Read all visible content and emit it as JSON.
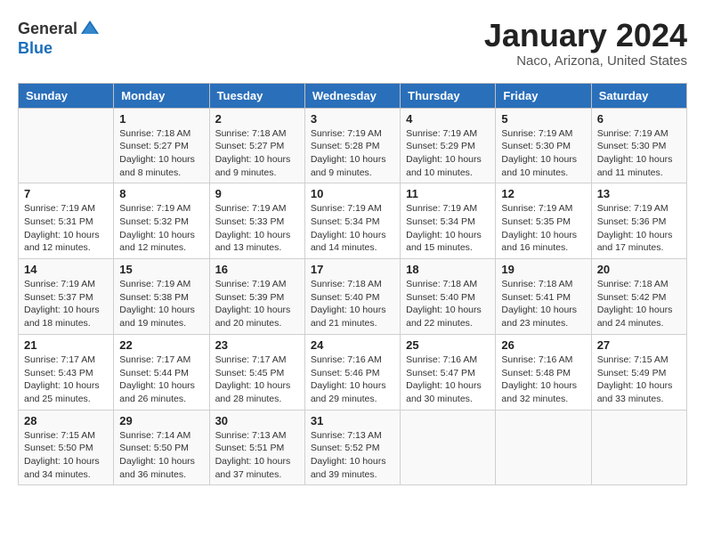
{
  "logo": {
    "general": "General",
    "blue": "Blue"
  },
  "title": "January 2024",
  "location": "Naco, Arizona, United States",
  "calendar": {
    "headers": [
      "Sunday",
      "Monday",
      "Tuesday",
      "Wednesday",
      "Thursday",
      "Friday",
      "Saturday"
    ],
    "weeks": [
      [
        {
          "day": "",
          "info": ""
        },
        {
          "day": "1",
          "info": "Sunrise: 7:18 AM\nSunset: 5:27 PM\nDaylight: 10 hours\nand 8 minutes."
        },
        {
          "day": "2",
          "info": "Sunrise: 7:18 AM\nSunset: 5:27 PM\nDaylight: 10 hours\nand 9 minutes."
        },
        {
          "day": "3",
          "info": "Sunrise: 7:19 AM\nSunset: 5:28 PM\nDaylight: 10 hours\nand 9 minutes."
        },
        {
          "day": "4",
          "info": "Sunrise: 7:19 AM\nSunset: 5:29 PM\nDaylight: 10 hours\nand 10 minutes."
        },
        {
          "day": "5",
          "info": "Sunrise: 7:19 AM\nSunset: 5:30 PM\nDaylight: 10 hours\nand 10 minutes."
        },
        {
          "day": "6",
          "info": "Sunrise: 7:19 AM\nSunset: 5:30 PM\nDaylight: 10 hours\nand 11 minutes."
        }
      ],
      [
        {
          "day": "7",
          "info": "Sunrise: 7:19 AM\nSunset: 5:31 PM\nDaylight: 10 hours\nand 12 minutes."
        },
        {
          "day": "8",
          "info": "Sunrise: 7:19 AM\nSunset: 5:32 PM\nDaylight: 10 hours\nand 12 minutes."
        },
        {
          "day": "9",
          "info": "Sunrise: 7:19 AM\nSunset: 5:33 PM\nDaylight: 10 hours\nand 13 minutes."
        },
        {
          "day": "10",
          "info": "Sunrise: 7:19 AM\nSunset: 5:34 PM\nDaylight: 10 hours\nand 14 minutes."
        },
        {
          "day": "11",
          "info": "Sunrise: 7:19 AM\nSunset: 5:34 PM\nDaylight: 10 hours\nand 15 minutes."
        },
        {
          "day": "12",
          "info": "Sunrise: 7:19 AM\nSunset: 5:35 PM\nDaylight: 10 hours\nand 16 minutes."
        },
        {
          "day": "13",
          "info": "Sunrise: 7:19 AM\nSunset: 5:36 PM\nDaylight: 10 hours\nand 17 minutes."
        }
      ],
      [
        {
          "day": "14",
          "info": "Sunrise: 7:19 AM\nSunset: 5:37 PM\nDaylight: 10 hours\nand 18 minutes."
        },
        {
          "day": "15",
          "info": "Sunrise: 7:19 AM\nSunset: 5:38 PM\nDaylight: 10 hours\nand 19 minutes."
        },
        {
          "day": "16",
          "info": "Sunrise: 7:19 AM\nSunset: 5:39 PM\nDaylight: 10 hours\nand 20 minutes."
        },
        {
          "day": "17",
          "info": "Sunrise: 7:18 AM\nSunset: 5:40 PM\nDaylight: 10 hours\nand 21 minutes."
        },
        {
          "day": "18",
          "info": "Sunrise: 7:18 AM\nSunset: 5:40 PM\nDaylight: 10 hours\nand 22 minutes."
        },
        {
          "day": "19",
          "info": "Sunrise: 7:18 AM\nSunset: 5:41 PM\nDaylight: 10 hours\nand 23 minutes."
        },
        {
          "day": "20",
          "info": "Sunrise: 7:18 AM\nSunset: 5:42 PM\nDaylight: 10 hours\nand 24 minutes."
        }
      ],
      [
        {
          "day": "21",
          "info": "Sunrise: 7:17 AM\nSunset: 5:43 PM\nDaylight: 10 hours\nand 25 minutes."
        },
        {
          "day": "22",
          "info": "Sunrise: 7:17 AM\nSunset: 5:44 PM\nDaylight: 10 hours\nand 26 minutes."
        },
        {
          "day": "23",
          "info": "Sunrise: 7:17 AM\nSunset: 5:45 PM\nDaylight: 10 hours\nand 28 minutes."
        },
        {
          "day": "24",
          "info": "Sunrise: 7:16 AM\nSunset: 5:46 PM\nDaylight: 10 hours\nand 29 minutes."
        },
        {
          "day": "25",
          "info": "Sunrise: 7:16 AM\nSunset: 5:47 PM\nDaylight: 10 hours\nand 30 minutes."
        },
        {
          "day": "26",
          "info": "Sunrise: 7:16 AM\nSunset: 5:48 PM\nDaylight: 10 hours\nand 32 minutes."
        },
        {
          "day": "27",
          "info": "Sunrise: 7:15 AM\nSunset: 5:49 PM\nDaylight: 10 hours\nand 33 minutes."
        }
      ],
      [
        {
          "day": "28",
          "info": "Sunrise: 7:15 AM\nSunset: 5:50 PM\nDaylight: 10 hours\nand 34 minutes."
        },
        {
          "day": "29",
          "info": "Sunrise: 7:14 AM\nSunset: 5:50 PM\nDaylight: 10 hours\nand 36 minutes."
        },
        {
          "day": "30",
          "info": "Sunrise: 7:13 AM\nSunset: 5:51 PM\nDaylight: 10 hours\nand 37 minutes."
        },
        {
          "day": "31",
          "info": "Sunrise: 7:13 AM\nSunset: 5:52 PM\nDaylight: 10 hours\nand 39 minutes."
        },
        {
          "day": "",
          "info": ""
        },
        {
          "day": "",
          "info": ""
        },
        {
          "day": "",
          "info": ""
        }
      ]
    ]
  }
}
